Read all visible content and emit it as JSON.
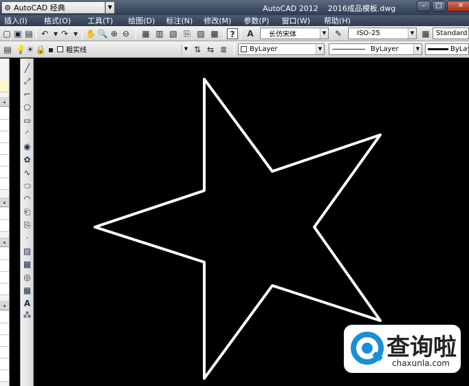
{
  "titlebar": {
    "workspace": "AutoCAD 经典",
    "app_name": "AutoCAD 2012",
    "file_name": "2016成品模板.dwg"
  },
  "menu": {
    "items": [
      "插入(I)",
      "格式(O)",
      "工具(T)",
      "绘图(D)",
      "标注(N)",
      "修改(M)",
      "参数(P)",
      "窗口(W)",
      "帮助(H)"
    ]
  },
  "styles_toolbar": {
    "text_style": "长仿宋体",
    "dim_style": "ISO-25",
    "table_style": "Standard"
  },
  "layers_toolbar": {
    "layer": "粗实线",
    "color": "ByLayer",
    "linetype": "ByLayer",
    "lineweight": "ByLay"
  },
  "draw_toolbar": {
    "text_tool": "A"
  },
  "canvas": {
    "shape": "star",
    "stroke_color": "#ffffff",
    "background": "#000000"
  },
  "watermark": {
    "title": "查询啦",
    "site": "chaxunla.com",
    "logo_color": "#1a8fd6"
  }
}
